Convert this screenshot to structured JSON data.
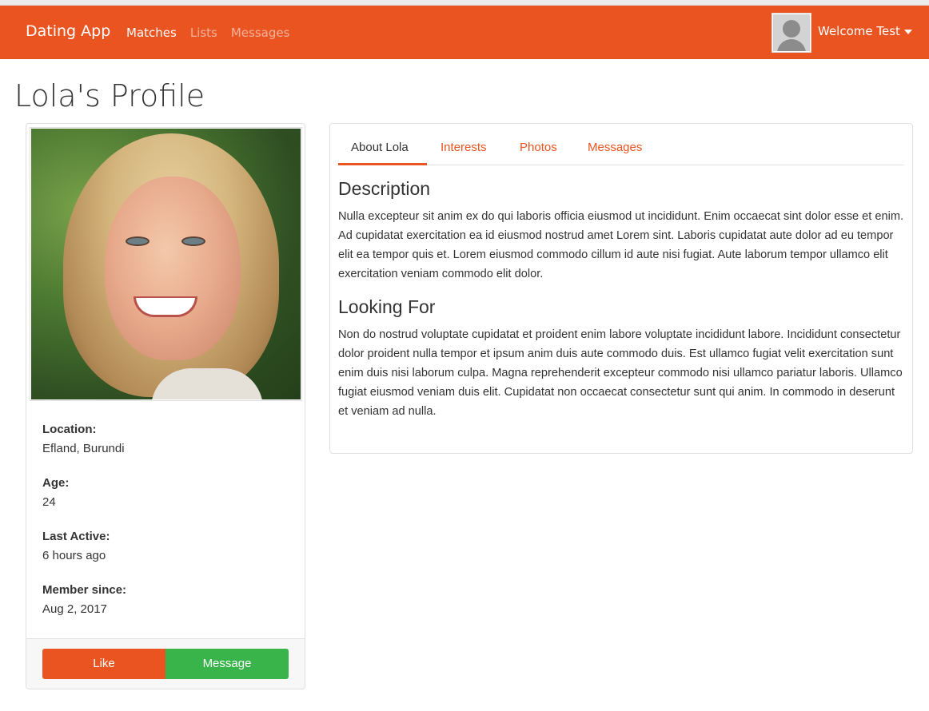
{
  "navbar": {
    "brand": "Dating App",
    "links": [
      {
        "label": "Matches",
        "active": true
      },
      {
        "label": "Lists",
        "active": false
      },
      {
        "label": "Messages",
        "active": false
      }
    ],
    "user_menu": {
      "label": "Welcome Test",
      "avatar_icon": "user-placeholder-icon"
    }
  },
  "page": {
    "title": "Lola's Profile"
  },
  "profile_card": {
    "photo_alt": "Lola",
    "info": [
      {
        "label": "Location:",
        "value": "Efland, Burundi"
      },
      {
        "label": "Age:",
        "value": "24"
      },
      {
        "label": "Last Active:",
        "value": "6 hours ago"
      },
      {
        "label": "Member since:",
        "value": "Aug 2, 2017"
      }
    ],
    "buttons": {
      "like": "Like",
      "message": "Message"
    }
  },
  "tabs": [
    {
      "label": "About Lola",
      "active": true
    },
    {
      "label": "Interests",
      "active": false
    },
    {
      "label": "Photos",
      "active": false
    },
    {
      "label": "Messages",
      "active": false
    }
  ],
  "about": {
    "description_heading": "Description",
    "description_text": "Nulla excepteur sit anim ex do qui laboris officia eiusmod ut incididunt. Enim occaecat sint dolor esse et enim. Ad cupidatat exercitation ea id eiusmod nostrud amet Lorem sint. Laboris cupidatat aute dolor ad eu tempor elit ea tempor quis et. Lorem eiusmod commodo cillum id aute nisi fugiat. Aute laborum tempor ullamco elit exercitation veniam commodo elit dolor.",
    "looking_for_heading": "Looking For",
    "looking_for_text": "Non do nostrud voluptate cupidatat et proident enim labore voluptate incididunt labore. Incididunt consectetur dolor proident nulla tempor et ipsum anim duis aute commodo duis. Est ullamco fugiat velit exercitation sunt enim duis nisi laborum culpa. Magna reprehenderit excepteur commodo nisi ullamco pariatur laboris. Ullamco fugiat eiusmod veniam duis elit. Cupidatat non occaecat consectetur sunt qui anim. In commodo in deserunt et veniam ad nulla."
  },
  "colors": {
    "primary": "#e95420",
    "success": "#38b44a",
    "text": "#333333"
  }
}
